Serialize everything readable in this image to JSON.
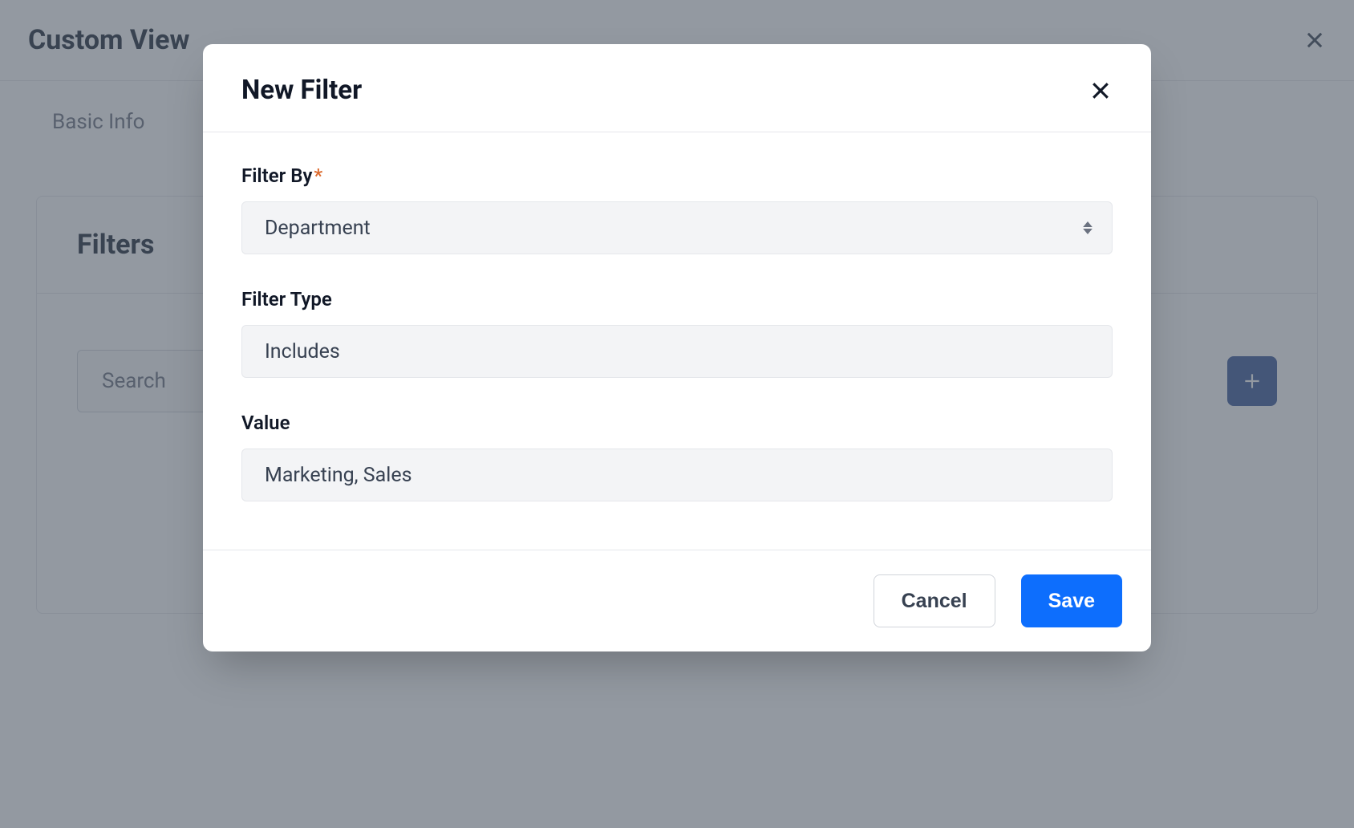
{
  "background": {
    "title": "Custom View",
    "tabs": [
      {
        "label": "Basic Info"
      }
    ],
    "card": {
      "title": "Filters",
      "search_placeholder": "Search"
    }
  },
  "modal": {
    "title": "New Filter",
    "fields": {
      "filter_by": {
        "label": "Filter By",
        "required": true,
        "value": "Department"
      },
      "filter_type": {
        "label": "Filter Type",
        "value": "Includes"
      },
      "value": {
        "label": "Value",
        "value": "Marketing, Sales"
      }
    },
    "buttons": {
      "cancel": "Cancel",
      "save": "Save"
    }
  }
}
